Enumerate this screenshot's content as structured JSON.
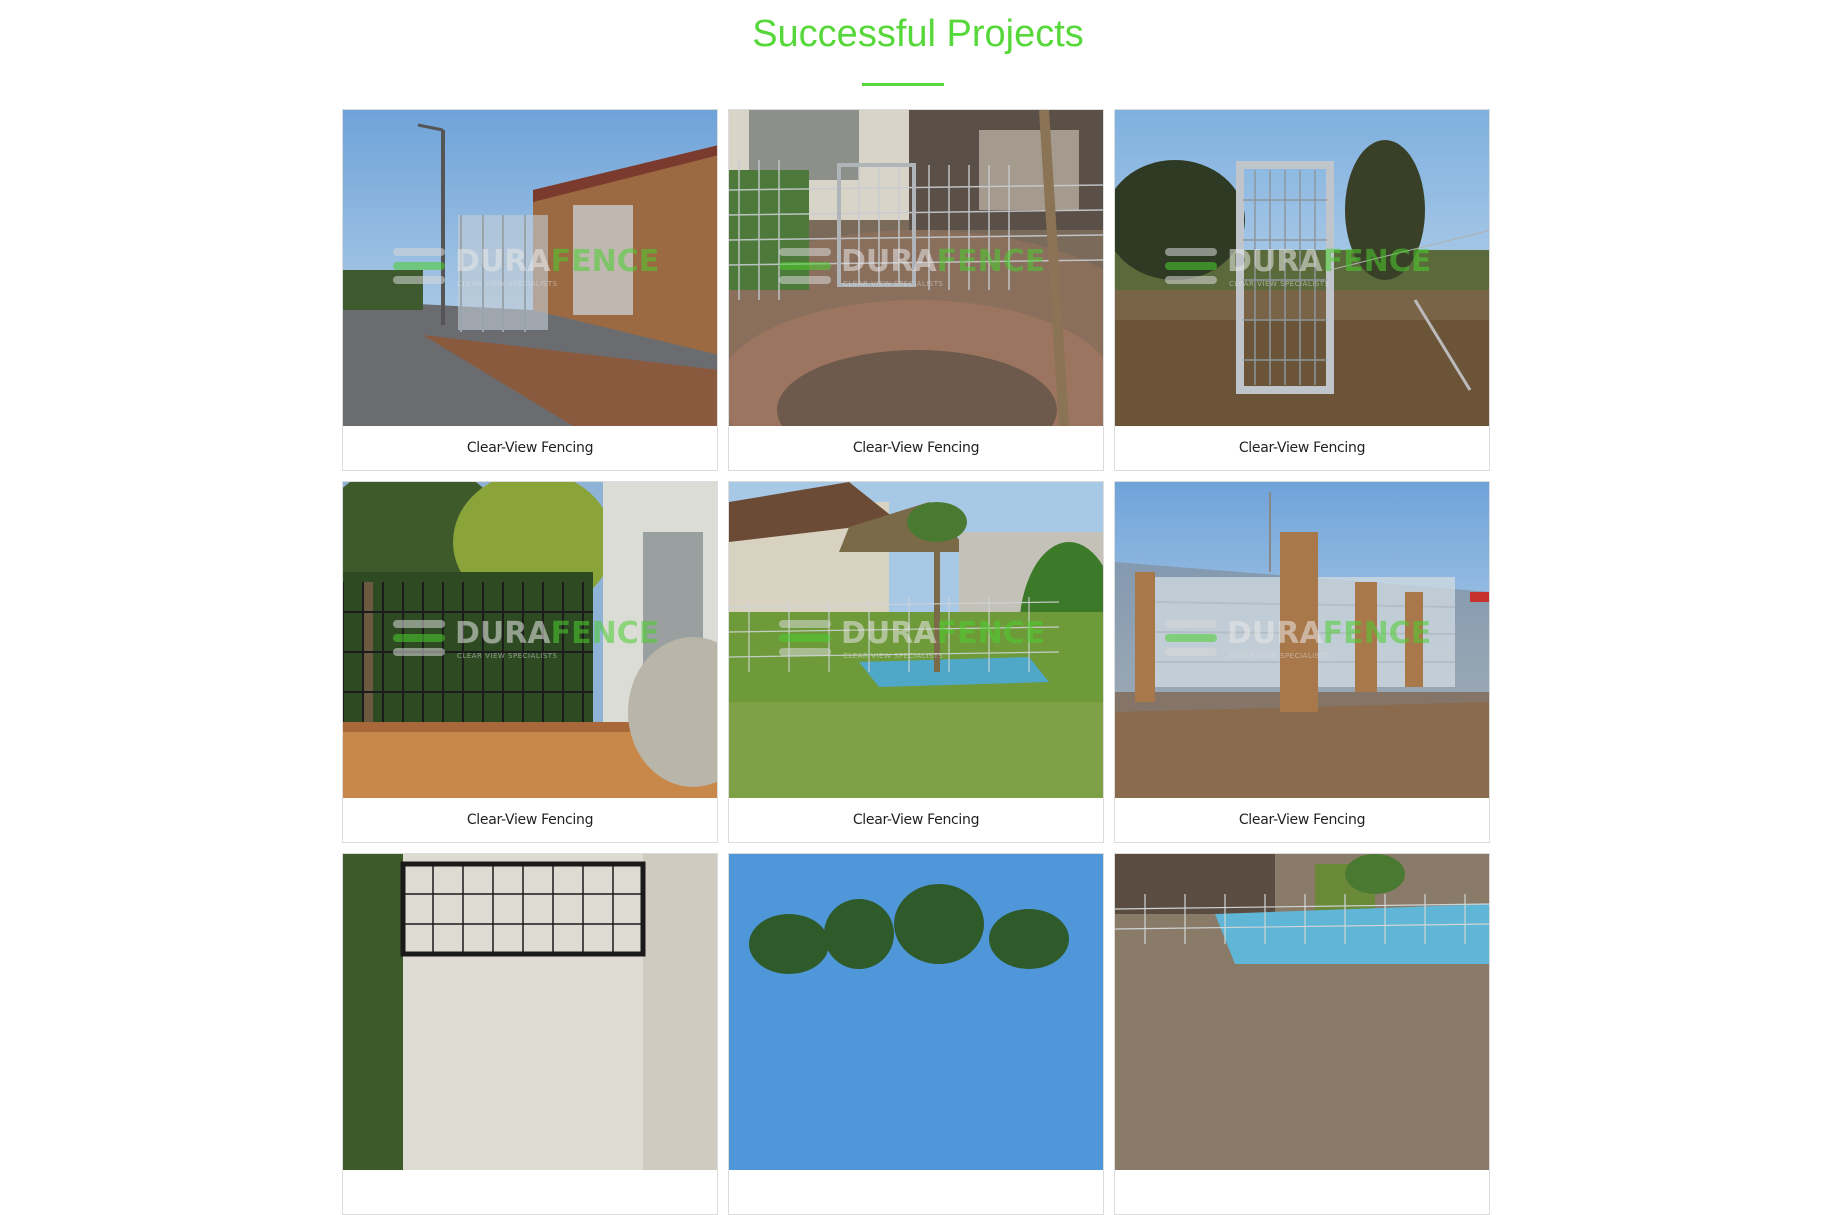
{
  "section": {
    "title": "Successful Projects"
  },
  "watermark": {
    "brand_part1": "DURA",
    "brand_part2": "FENCE",
    "tagline": "CLEAR VIEW SPECIALISTS",
    "brand_green": "#4ccf2f"
  },
  "accent_color": "#57d83a",
  "projects": [
    {
      "caption": "Clear-View Fencing",
      "scene": "street-brick-house-clear-fence"
    },
    {
      "caption": "Clear-View Fencing",
      "scene": "paved-courtyard-mesh-gate"
    },
    {
      "caption": "Clear-View Fencing",
      "scene": "field-mesh-gate"
    },
    {
      "caption": "Clear-View Fencing",
      "scene": "garden-black-mesh-fence"
    },
    {
      "caption": "Clear-View Fencing",
      "scene": "lawn-pool-mesh-fence"
    },
    {
      "caption": "Clear-View Fencing",
      "scene": "brick-pillars-clear-panels"
    },
    {
      "caption": "",
      "scene": "black-mesh-gate-building"
    },
    {
      "caption": "",
      "scene": "blue-sky-trees"
    },
    {
      "caption": "",
      "scene": "pool-mesh-fence"
    }
  ]
}
